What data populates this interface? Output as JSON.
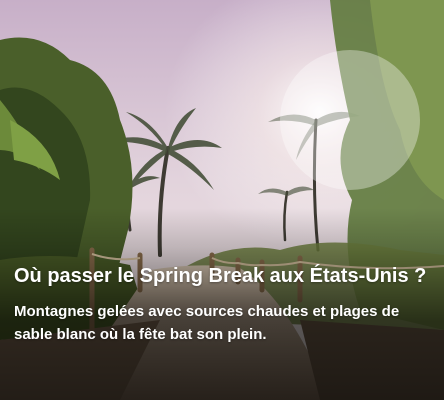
{
  "article_card": {
    "headline": "Où passer le Spring Break aux États-Unis ?",
    "subtitle": "Montagnes gelées avec sources chaudes et plages de sable blanc où la fête bat son plein.",
    "text_color": "#ffffff",
    "image": {
      "sky_top": "#cdb6cf",
      "sky_bottom": "#f3ece8",
      "sand": "#b9a48c",
      "foliage": "#3f5a2a"
    }
  }
}
